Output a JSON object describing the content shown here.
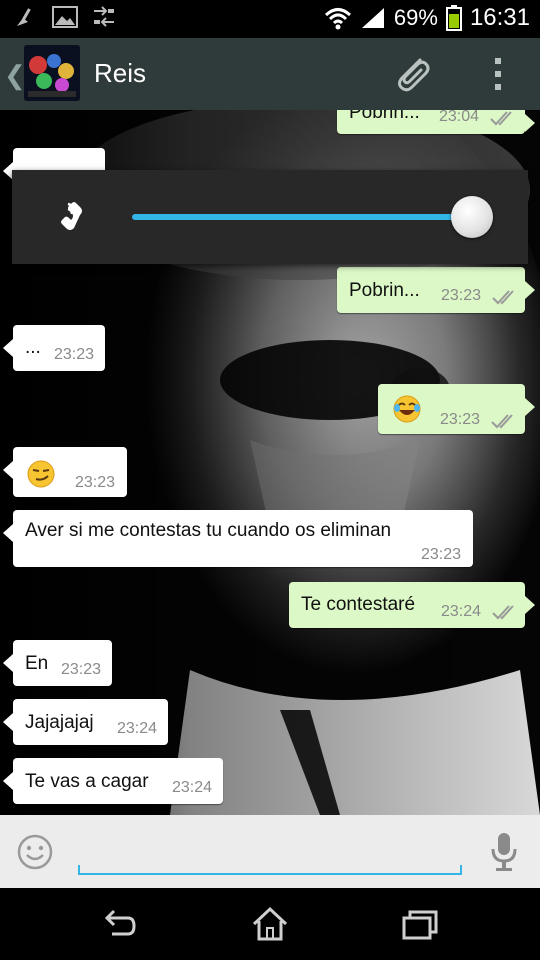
{
  "status_bar": {
    "battery": "69%",
    "time": "16:31"
  },
  "header": {
    "contact_name": "Reis"
  },
  "volume_panel": {
    "level": 1.0
  },
  "messages": [
    {
      "dir": "out",
      "text": "Pobrin...",
      "time": "23:04",
      "ticks": "double"
    },
    {
      "dir": "in",
      "text": "",
      "time": ""
    },
    {
      "dir": "out",
      "text": "Pobrin...",
      "time": "23:23",
      "ticks": "double"
    },
    {
      "dir": "in",
      "text": "...",
      "time": "23:23"
    },
    {
      "dir": "out",
      "emoji": "face-with-tears-of-joy",
      "time": "23:23",
      "ticks": "double"
    },
    {
      "dir": "in",
      "emoji": "smirking-face",
      "time": "23:23"
    },
    {
      "dir": "in",
      "text": "Aver si me contestas tu cuando os eliminan",
      "time": "23:23"
    },
    {
      "dir": "out",
      "text": "Te contestaré",
      "time": "23:24",
      "ticks": "double"
    },
    {
      "dir": "in",
      "text": "En",
      "time": "23:23"
    },
    {
      "dir": "in",
      "text": "Jajajajaj",
      "time": "23:24"
    },
    {
      "dir": "in",
      "text": "Te vas a cagar",
      "time": "23:24"
    }
  ],
  "composer": {
    "placeholder": ""
  },
  "icons": {
    "status_left": [
      "cleaner-icon",
      "gallery-icon",
      "data-sync-icon"
    ],
    "status_right": [
      "wifi-icon",
      "signal-icon",
      "battery-icon"
    ],
    "header": [
      "back-chevron-icon",
      "avatar",
      "attach-icon",
      "overflow-menu-icon"
    ],
    "volume": "phone-call-volume-icon",
    "composer": [
      "smiley-icon",
      "microphone-icon"
    ],
    "nav": [
      "back-icon",
      "home-icon",
      "recent-apps-icon"
    ]
  },
  "colors": {
    "action_bar": "#2f3b3a",
    "outgoing_bubble": "#dcf8c6",
    "incoming_bubble": "#ffffff",
    "accent": "#33b5e5",
    "battery": "#99cc00"
  }
}
